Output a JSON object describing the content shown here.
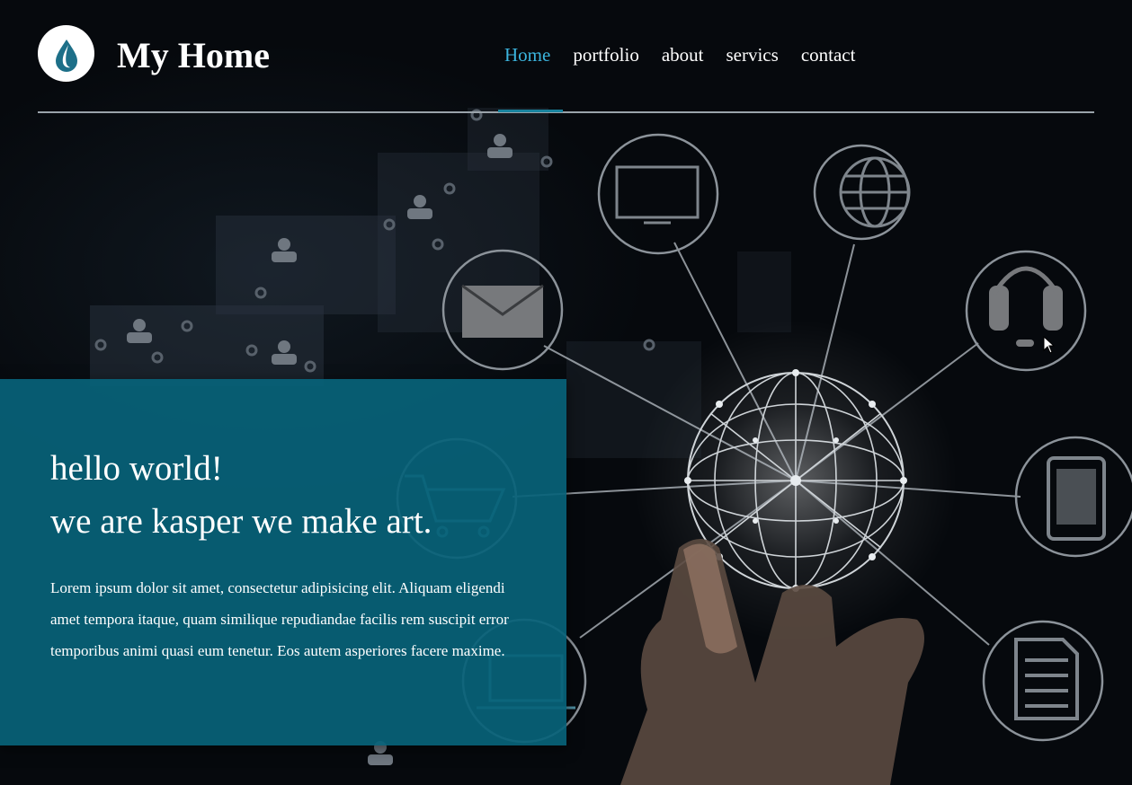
{
  "header": {
    "brand": "My Home",
    "nav": [
      "Home",
      "portfolio",
      "about",
      "servics",
      "contact"
    ],
    "active_nav": "Home"
  },
  "hero": {
    "title_line1": "hello world!",
    "title_line2": "we are kasper we make art.",
    "paragraph": "Lorem ipsum dolor sit amet, consectetur adipisicing elit. Aliquam eligendi amet tempora itaque, quam similique repudiandae facilis rem suscipit error temporibus animi quasi eum tenetur. Eos autem asperiores facere maxime."
  },
  "icons": [
    "water-drop-logo-icon",
    "monitor-icon",
    "globe-icon",
    "envelope-icon",
    "headset-icon",
    "shopping-cart-icon",
    "tablet-icon",
    "laptop-icon",
    "document-icon",
    "person-icon",
    "network-sphere-icon",
    "mouse-cursor-icon"
  ],
  "colors": {
    "accent": "#3bb4dd",
    "panel": "#086279",
    "background": "#05080c",
    "text": "#ffffff"
  }
}
